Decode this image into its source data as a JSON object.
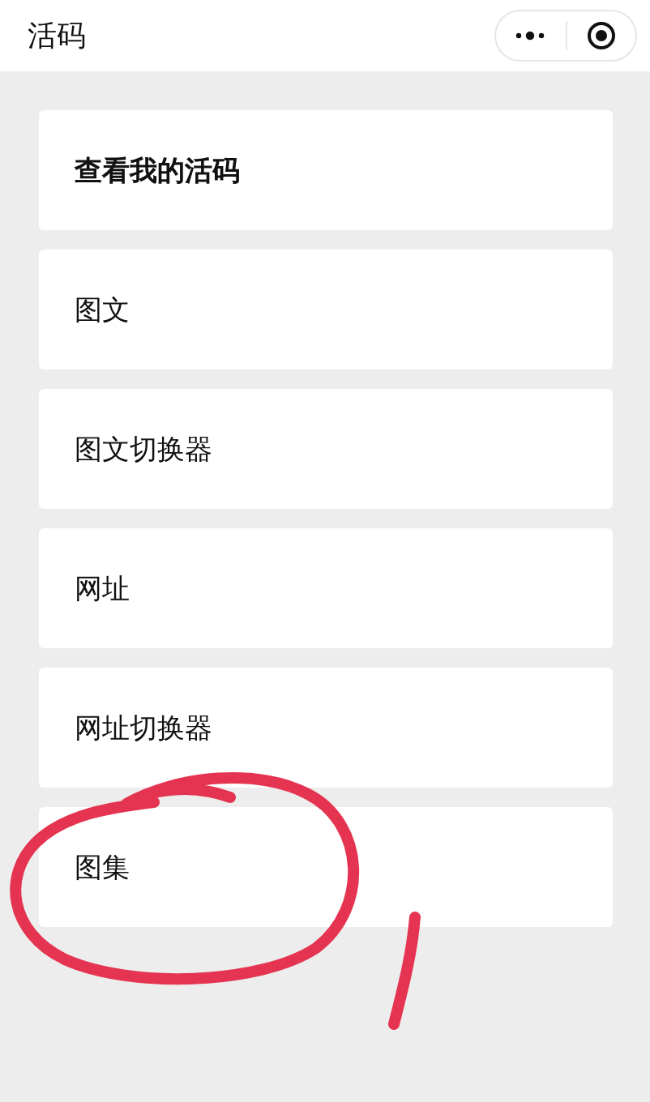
{
  "header": {
    "title": "活码"
  },
  "items": [
    {
      "label": "查看我的活码",
      "kind": "heading"
    },
    {
      "label": "图文",
      "kind": "plain"
    },
    {
      "label": "图文切换器",
      "kind": "plain"
    },
    {
      "label": "网址",
      "kind": "plain"
    },
    {
      "label": "网址切换器",
      "kind": "plain"
    },
    {
      "label": "图集",
      "kind": "plain"
    }
  ]
}
